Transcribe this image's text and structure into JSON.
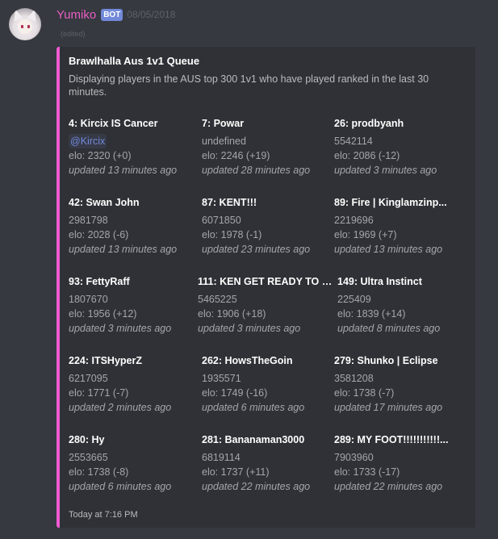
{
  "message": {
    "username": "Yumiko",
    "bot_tag": "BOT",
    "timestamp": "08/05/2018",
    "edited": "(edited)"
  },
  "embed": {
    "accent_color": "#ee5bd1",
    "title": "Brawlhalla Aus 1v1 Queue",
    "description": "Displaying players in the AUS top 300 1v1 who have played ranked in the last 30 minutes.",
    "footer": "Today at 7:16 PM",
    "fields": [
      {
        "name": "4: Kircix IS Cancer",
        "line1": "@Kircix",
        "line2": "elo: 2320 (+0)",
        "line3": "updated 13 minutes ago"
      },
      {
        "name": "7: Powar",
        "line1": "undefined",
        "line2": "elo: 2246 (+19)",
        "line3": "updated 28 minutes ago"
      },
      {
        "name": "26: prodbyanh",
        "line1": "5542114",
        "line2": "elo: 2086 (-12)",
        "line3": "updated 3 minutes ago"
      },
      {
        "name": "42: Swan John",
        "line1": "2981798",
        "line2": "elo: 2028 (-6)",
        "line3": "updated 13 minutes ago"
      },
      {
        "name": "87: KENT!!!",
        "line1": "6071850",
        "line2": "elo: 1978 (-1)",
        "line3": "updated 23 minutes ago"
      },
      {
        "name": "89: Fire | Kinglamzinp...",
        "line1": "2219696",
        "line2": "elo: 1969 (+7)",
        "line3": "updated 13 minutes ago"
      },
      {
        "name": "93: FettyRaff",
        "line1": "1807670",
        "line2": "elo: 1956 (+12)",
        "line3": "updated 3 minutes ago"
      },
      {
        "name": "111: KEN GET READY TO L...",
        "line1": "5465225",
        "line2": "elo: 1906 (+18)",
        "line3": "updated 3 minutes ago"
      },
      {
        "name": "149: Ultra Instinct",
        "line1": "225409",
        "line2": "elo: 1839 (+14)",
        "line3": "updated 8 minutes ago"
      },
      {
        "name": "224: ITSHyperZ",
        "line1": "6217095",
        "line2": "elo: 1771 (-7)",
        "line3": "updated 2 minutes ago"
      },
      {
        "name": "262: HowsTheGoin",
        "line1": "1935571",
        "line2": "elo: 1749 (-16)",
        "line3": "updated 6 minutes ago"
      },
      {
        "name": "279: Shunko | Eclipse",
        "line1": "3581208",
        "line2": "elo: 1738 (-7)",
        "line3": "updated 17 minutes ago"
      },
      {
        "name": "280: Hy",
        "line1": "2553665",
        "line2": "elo: 1738 (-8)",
        "line3": "updated 6 minutes ago"
      },
      {
        "name": "281: Bananaman3000",
        "line1": "6819114",
        "line2": "elo: 1737 (+11)",
        "line3": "updated 22 minutes ago"
      },
      {
        "name": "289: MY FOOT!!!!!!!!!!!...",
        "line1": "7903960",
        "line2": "elo: 1733 (-17)",
        "line3": "updated 22 minutes ago"
      }
    ]
  }
}
